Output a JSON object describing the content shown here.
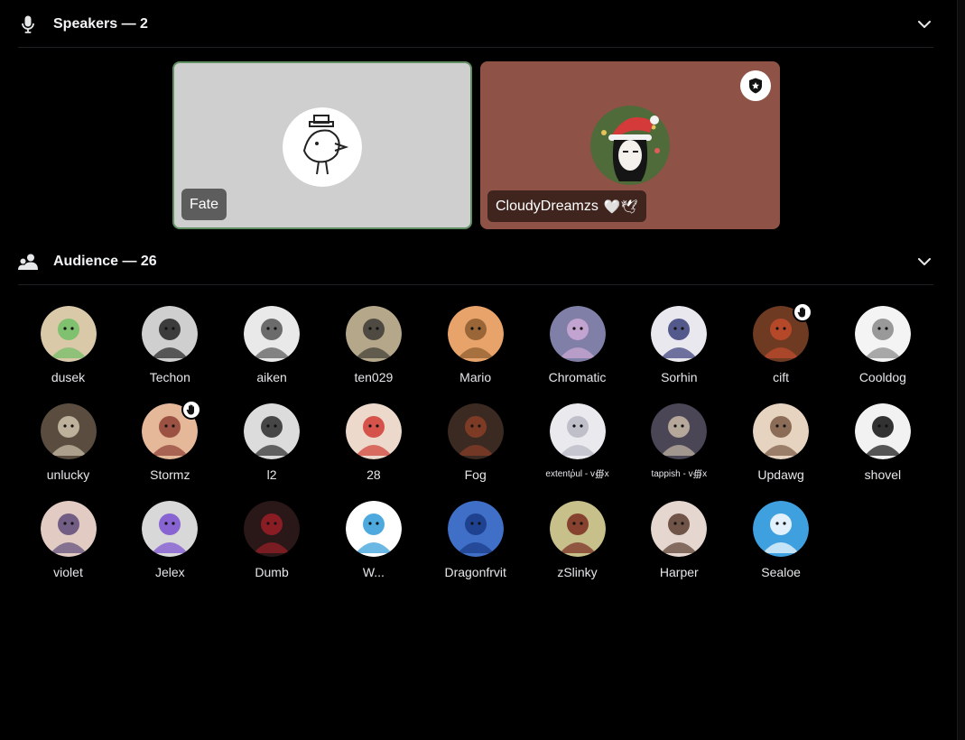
{
  "speakers": {
    "title": "Speakers — 2",
    "icon": "microphone-icon",
    "tiles": [
      {
        "name": "Fate",
        "emoji": "",
        "bg": "#cfcfcf"
      },
      {
        "name": "CloudyDreamzs",
        "emoji": "🤍🕊",
        "bg": "#8f5246",
        "badge": "moderator-shield-icon"
      }
    ]
  },
  "audience": {
    "title": "Audience — 26",
    "icon": "people-icon",
    "members": [
      {
        "name": "dusek",
        "color": "#d9c9a8",
        "accent": "#6fbf64"
      },
      {
        "name": "Techon",
        "color": "#cfcfcf",
        "accent": "#222222"
      },
      {
        "name": "aiken",
        "color": "#e9e9e9",
        "accent": "#555555"
      },
      {
        "name": "ten029",
        "color": "#b5a78a",
        "accent": "#3d3a34"
      },
      {
        "name": "Mario",
        "color": "#e7a36a",
        "accent": "#8c5a2e"
      },
      {
        "name": "Chromatic",
        "color": "#7f7fa8",
        "accent": "#cfa9d6"
      },
      {
        "name": "Sorhin",
        "color": "#e8e8ee",
        "accent": "#3a3f7a"
      },
      {
        "name": "cift",
        "color": "#6e3a22",
        "accent": "#c34b2c",
        "hand": true
      },
      {
        "name": "Cooldog",
        "color": "#f4f4f4",
        "accent": "#888888"
      },
      {
        "name": "unlucky",
        "color": "#5a4d40",
        "accent": "#cfc3ad"
      },
      {
        "name": "Stormz",
        "color": "#e6b89a",
        "accent": "#8e3f33",
        "hand": true
      },
      {
        "name": "l2",
        "color": "#dcdcdc",
        "accent": "#2b2b2b"
      },
      {
        "name": "28",
        "color": "#ecd9cc",
        "accent": "#d13b32"
      },
      {
        "name": "Fog",
        "color": "#3b2a22",
        "accent": "#8a3e26"
      },
      {
        "name": "extentῥul - v∰x",
        "color": "#e9e9ee",
        "accent": "#b7b7c3",
        "small": true
      },
      {
        "name": "tappish - v∰x",
        "color": "#4a4656",
        "accent": "#c8b9a6",
        "small": true
      },
      {
        "name": "Updawg",
        "color": "#e6d3c0",
        "accent": "#7a5a44"
      },
      {
        "name": "shovel",
        "color": "#f2f2f2",
        "accent": "#111111"
      },
      {
        "name": "violet",
        "color": "#e2cbc3",
        "accent": "#5e4b7a"
      },
      {
        "name": "Jelex",
        "color": "#d8d8d8",
        "accent": "#7a4fd1"
      },
      {
        "name": "Dumb",
        "color": "#2a1818",
        "accent": "#9b1f27"
      },
      {
        "name": "W...",
        "color": "#ffffff",
        "accent": "#2e9ad8"
      },
      {
        "name": "Dragonfrvit",
        "color": "#3f6fc7",
        "accent": "#1a3b86"
      },
      {
        "name": "zSlinky",
        "color": "#c7c08a",
        "accent": "#7a2a1f"
      },
      {
        "name": "Harper",
        "color": "#e5d6cf",
        "accent": "#5b3d2f"
      },
      {
        "name": "Sealoe",
        "color": "#3fa0e0",
        "accent": "#ffffff"
      }
    ]
  }
}
